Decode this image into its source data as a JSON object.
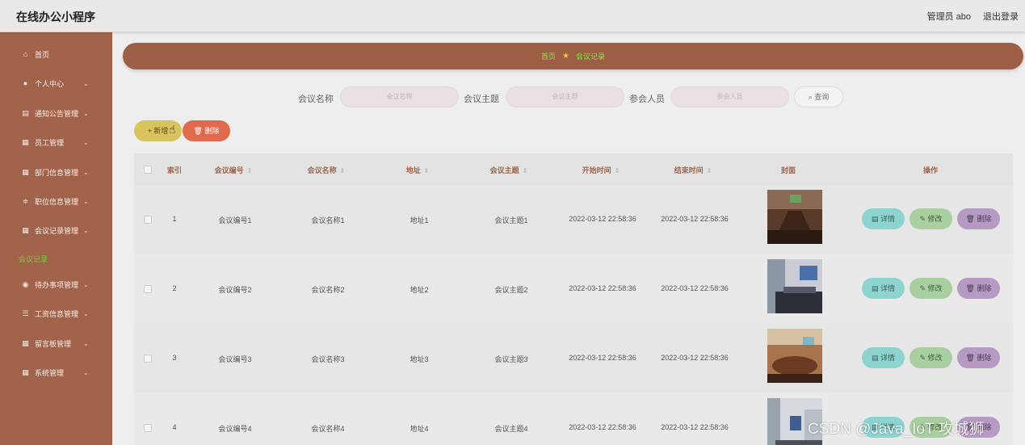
{
  "app": {
    "title": "在线办公小程序",
    "user": "管理员 abo",
    "logout": "退出登录"
  },
  "sidebar": {
    "items": [
      {
        "label": "首页",
        "icon": "home-icon"
      },
      {
        "label": "个人中心",
        "icon": "user-icon"
      },
      {
        "label": "通知公告管理",
        "icon": "notice-icon"
      },
      {
        "label": "员工管理",
        "icon": "grid-icon"
      },
      {
        "label": "部门信息管理",
        "icon": "grid-icon"
      },
      {
        "label": "职位信息管理",
        "icon": "sliders-icon"
      },
      {
        "label": "会议记录管理",
        "icon": "grid-icon"
      },
      {
        "label": "待办事项管理",
        "icon": "coin-icon"
      },
      {
        "label": "工资信息管理",
        "icon": "list-icon"
      },
      {
        "label": "留言板管理",
        "icon": "grid-icon"
      },
      {
        "label": "系统管理",
        "icon": "grid-icon"
      }
    ],
    "sub_active": "会议记录"
  },
  "breadcrumb": {
    "home": "首页",
    "current": "会议记录"
  },
  "search": {
    "name_label": "会议名称",
    "name_placeholder": "会议名称",
    "topic_label": "会议主题",
    "topic_placeholder": "会议主题",
    "attendee_label": "参会人员",
    "attendee_placeholder": "参会人员",
    "button": "查询"
  },
  "actions": {
    "add": "新增",
    "delete": "删除"
  },
  "table": {
    "headers": {
      "index": "索引",
      "code": "会议编号",
      "name": "会议名称",
      "address": "地址",
      "topic": "会议主题",
      "start": "开始时间",
      "end": "结束时间",
      "cover": "封面",
      "ops": "操作"
    },
    "ops": {
      "detail": "详情",
      "edit": "修改",
      "remove": "删除"
    },
    "rows": [
      {
        "index": "1",
        "code": "会议编号1",
        "name": "会议名称1",
        "address": "地址1",
        "topic": "会议主题1",
        "start": "2022-03-12 22:58:36",
        "end": "2022-03-12 22:58:36"
      },
      {
        "index": "2",
        "code": "会议编号2",
        "name": "会议名称2",
        "address": "地址2",
        "topic": "会议主题2",
        "start": "2022-03-12 22:58:36",
        "end": "2022-03-12 22:58:36"
      },
      {
        "index": "3",
        "code": "会议编号3",
        "name": "会议名称3",
        "address": "地址3",
        "topic": "会议主题3",
        "start": "2022-03-12 22:58:36",
        "end": "2022-03-12 22:58:36"
      },
      {
        "index": "4",
        "code": "会议编号4",
        "name": "会议名称4",
        "address": "地址4",
        "topic": "会议主题4",
        "start": "2022-03-12 22:58:36",
        "end": "2022-03-12 22:58:36"
      }
    ]
  },
  "watermark": "CSDN @Java_IoT 攻城狮"
}
